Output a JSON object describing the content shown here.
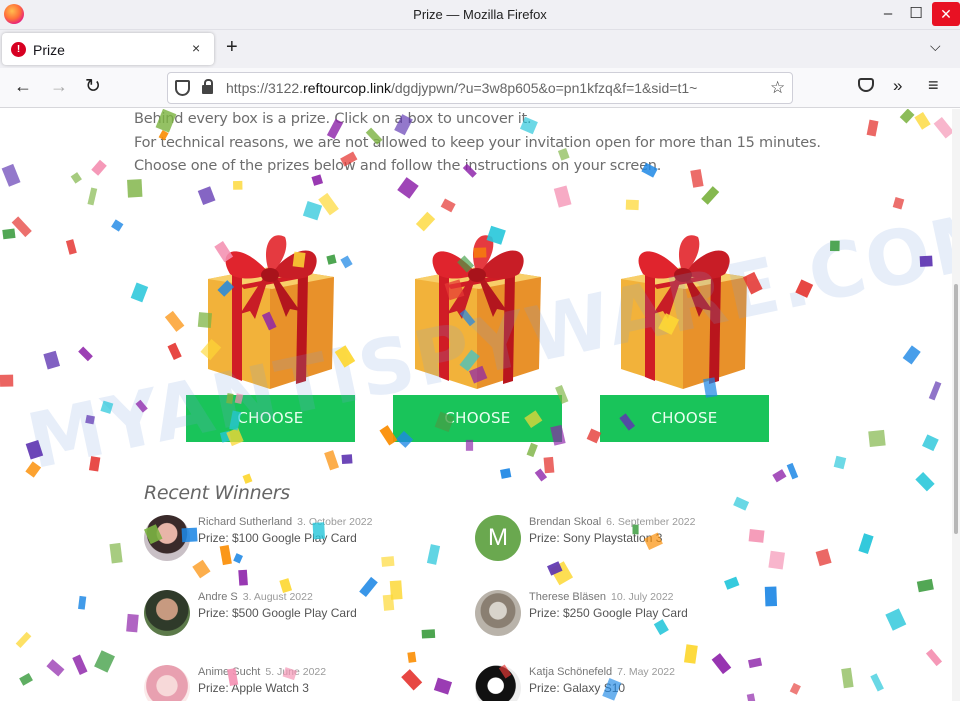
{
  "window": {
    "title": "Prize — Mozilla Firefox",
    "min_icon": "minimize-icon",
    "max_icon": "maximize-icon",
    "close_icon": "close-icon"
  },
  "tab": {
    "label": "Prize",
    "badge": "!",
    "close": "×",
    "new_tab": "+",
    "list": "⌄"
  },
  "nav": {
    "url_prefix": "https://3122.",
    "url_domain": "reftourcop.link",
    "url_path": "/dgdjypwn/?u=3w8p605&o=pn1kfzq&f=1&sid=t1~",
    "back": "←",
    "forward": "→",
    "reload": "↻",
    "star": "☆",
    "overflow": "»",
    "menu": "≡"
  },
  "page": {
    "intro_line1": "Behind every box is a prize. Click on a box to uncover it.",
    "intro_line2": "For technical reasons, we are not allowed to keep your invitation open for more than 15 minutes.",
    "intro_line3": "Choose one of the prizes below and follow the instructions on your screen.",
    "choose_label": "CHOOSE",
    "winners_title": "Recent Winners",
    "watermark": "MYANTISPYWARE.COM"
  },
  "winners": [
    {
      "name": "Richard Sutherland",
      "date": "3. October 2022",
      "prize": "Prize: $100 Google Play Card",
      "avatar": "photo"
    },
    {
      "name": "Brendan Skoal",
      "date": "6. September 2022",
      "prize": "Prize: Sony Playstation 3",
      "avatar": "M"
    },
    {
      "name": "Andre S",
      "date": "3. August 2022",
      "prize": "Prize: $500 Google Play Card",
      "avatar": "photo"
    },
    {
      "name": "Therese Bläsen",
      "date": "10. July 2022",
      "prize": "Prize: $250 Google Play Card",
      "avatar": "cat"
    },
    {
      "name": "Anime Sucht",
      "date": "5. June 2022",
      "prize": "Prize: Apple Watch 3",
      "avatar": "photo"
    },
    {
      "name": "Katja Schönefeld",
      "date": "7. May 2022",
      "prize": "Prize: Galaxy S10",
      "avatar": "sketch"
    }
  ],
  "colors": {
    "choose_button": "#19c45a",
    "avatar_m": "#6aa84f",
    "confetti": [
      "#e53935",
      "#1e88e5",
      "#fdd835",
      "#43a047",
      "#8e24aa",
      "#fb8c00",
      "#f48fb1",
      "#26c6da",
      "#7cb342",
      "#5e35b1"
    ]
  }
}
